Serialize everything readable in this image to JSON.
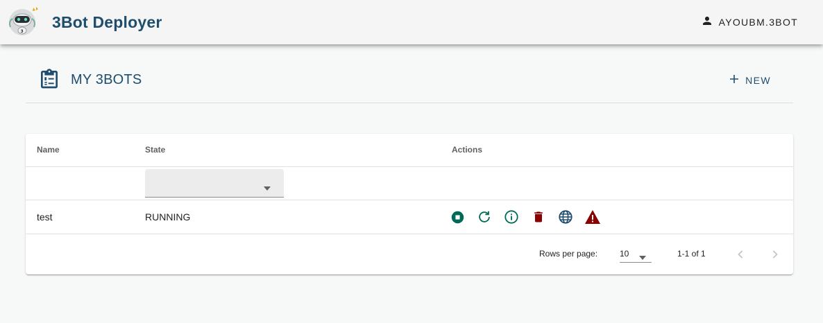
{
  "app": {
    "title": "3Bot Deployer",
    "user": "AYOUBM.3BOT"
  },
  "section": {
    "title": "MY 3BOTS",
    "new_label": "NEW"
  },
  "table": {
    "headers": [
      "Name",
      "State",
      "Actions"
    ],
    "state_filter_value": "",
    "rows": [
      {
        "name": "test",
        "state": "RUNNING",
        "actions": [
          "stop-icon",
          "restart-icon",
          "info-icon",
          "delete-icon",
          "web-icon",
          "alert-icon"
        ]
      }
    ],
    "footer": {
      "rows_per_page_label": "Rows per page:",
      "rows_per_page_value": "10",
      "range_text": "1-1 of 1"
    }
  },
  "colors": {
    "brand": "#1e4d6e",
    "action_teal": "#006a58",
    "danger": "#8b0000",
    "globe": "#1e4d6e"
  }
}
